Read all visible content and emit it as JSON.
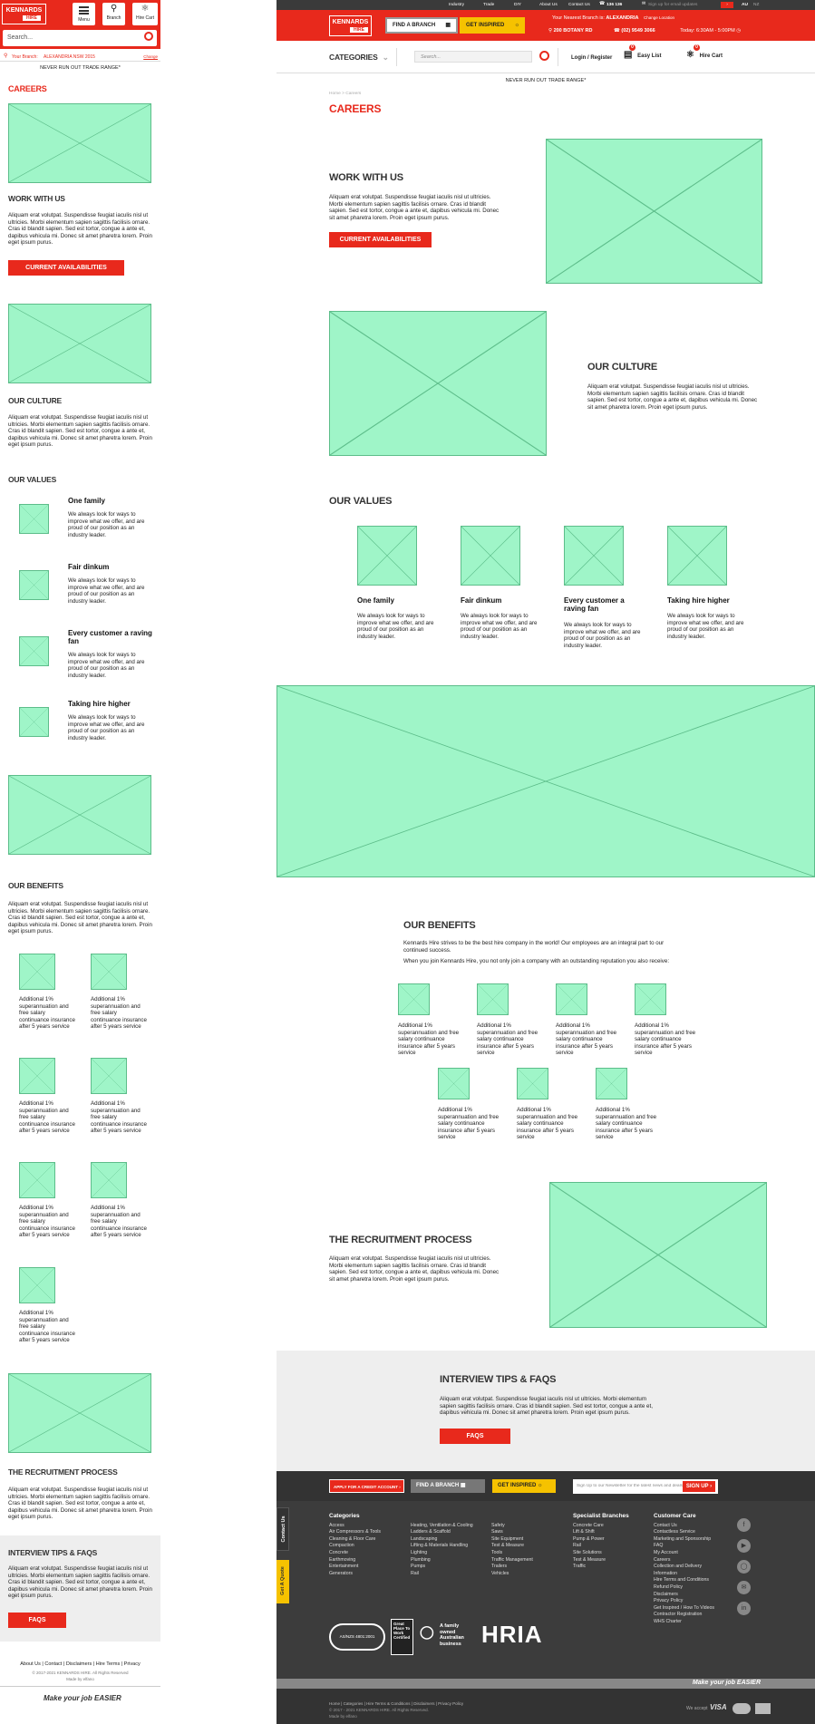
{
  "brand": {
    "name_top": "KENNARDS",
    "name_bottom": "HIRE",
    "tagline": "Make your job EASIER"
  },
  "colors": {
    "brand_red": "#e8291c",
    "yellow": "#f6c200",
    "placeholder_green": "#9ff5c8",
    "dark": "#333333",
    "footer_bg": "#3c3c3c"
  },
  "mobile": {
    "header": {
      "menu_label": "Menu",
      "branch_label": "Branch",
      "cart_label": "Hire Cart"
    },
    "search_placeholder": "Search...",
    "branch_bar": {
      "prefix": "Your Branch:",
      "branch": "ALEXANDRIA NSW 2015",
      "change": "Change"
    },
    "promo": "NEVER RUN OUT TRADE RANGE*",
    "page_title": "CAREERS",
    "work_title": "WORK WITH US",
    "lorem": "Aliquam erat volutpat. Suspendisse feugiat iaculis nisl ut ultricies. Morbi elementum sapien sagittis facilisis ornare. Cras id blandit sapien. Sed est tortor, congue a ante et, dapibus vehicula mi. Donec sit amet pharetra lorem. Proin eget ipsum purus.",
    "cta": "CURRENT AVAILABILITIES",
    "culture_title": "OUR CULTURE",
    "values_title": "OUR VALUES",
    "benefits_title": "OUR BENEFITS",
    "recruit_title": "THE RECRUITMENT PROCESS",
    "faq_title": "INTERVIEW TIPS & FAQs",
    "faq_btn": "FAQs",
    "footer_links": "About Us | Contact | Disclaimers | Hire Terms | Privacy",
    "copyright": "© 2017-2021 KENNARDS HIRE. All Rights Reserved",
    "made_by": "Made by elfano"
  },
  "values": [
    {
      "title": "One family",
      "text": "We always look for ways to improve what we offer, and are proud of our position as an industry leader."
    },
    {
      "title": "Fair dinkum",
      "text": "We always look for ways to improve what we offer, and are proud of our position as an industry leader."
    },
    {
      "title": "Every customer a raving fan",
      "text": "We always look for ways to improve what we offer, and are proud of our position as an industry leader."
    },
    {
      "title": "Taking hire higher",
      "text": "We always look for ways to improve what we offer, and are proud of our position as an industry leader."
    }
  ],
  "benefit_text": "Additional 1% superannuation and free salary continuance insurance after 5 years service",
  "desktop": {
    "topbar": {
      "industry": "Industry",
      "trade": "Trade",
      "diy": "DIY",
      "about": "About Us",
      "contact": "Contact Us",
      "phone": "136 136",
      "email_placeholder": "Sign up for email updates",
      "au": "AU",
      "nz": "NZ"
    },
    "find_branch": "FIND A BRANCH",
    "get_inspired": "GET INSPIRED",
    "nearest_prefix": "Your Nearest Branch is:",
    "nearest_branch": "ALEXANDRIA",
    "change_location": "Change Location",
    "address": "200 BOTANY RD",
    "branch_phone": "(02) 9549 3066",
    "hours": "Today: 6:30AM - 5:00PM",
    "categories": "CATEGORIES",
    "search_placeholder": "Search...",
    "login": "Login / Register",
    "easy_list": "Easy List",
    "hire_cart": "Hire Cart",
    "easy_count": "0",
    "cart_count": "0",
    "promo": "NEVER RUN OUT TRADE RANGE*",
    "breadcrumb": "Home > Careers",
    "page_title": "CAREERS",
    "work_title": "WORK WITH US",
    "lorem": "Aliquam erat volutpat. Suspendisse feugiat iaculis nisl ut ultricies. Morbi elementum sapien sagittis facilisis ornare. Cras id blandit sapien. Sed est tortor, congue a ante et, dapibus vehicula mi. Donec sit amet pharetra lorem. Proin eget ipsum purus.",
    "cta": "CURRENT AVAILABILITIES",
    "culture_title": "OUR CULTURE",
    "values_title": "OUR VALUES",
    "benefits_title": "OUR BENEFITS",
    "benefits_intro1": "Kennards Hire strives to be the best hire company in the world! Our employees are an integral part to our continued success.",
    "benefits_intro2": "When you join Kennards Hire, you not only join a company with an outstanding reputation you also receive:",
    "recruit_title": "THE RECRUITMENT PROCESS",
    "faq_title": "INTERVIEW TIPS & FAQs",
    "faq_btn": "FAQs",
    "footer": {
      "apply": "APPLY FOR A CREDIT ACCOUNT",
      "find_branch": "FIND A BRANCH",
      "get_inspired": "GET INSPIRED",
      "newsletter_placeholder": "Sign Up to our Newsletter for the latest news and deals",
      "signup": "SIGN UP",
      "contact_tab": "Contact Us",
      "quote_tab": "Get A Quote",
      "cat_title": "Categories",
      "cat1": [
        "Access",
        "Air Compressors & Tools",
        "Cleaning & Floor Care",
        "Compaction",
        "Concrete",
        "Earthmoving",
        "Entertainment",
        "Generators"
      ],
      "cat2": [
        "Heating, Ventilation & Cooling",
        "Ladders & Scaffold",
        "Landscaping",
        "Lifting & Materials Handling",
        "Lighting",
        "Plumbing",
        "Pumps",
        "Rail"
      ],
      "cat3": [
        "Safety",
        "Saws",
        "Site Equipment",
        "Test & Measure",
        "Tools",
        "Traffic Management",
        "Trailers",
        "Vehicles"
      ],
      "spec_title": "Specialist Branches",
      "spec": [
        "Concrete Care",
        "Lift & Shift",
        "Pump & Power",
        "Rail",
        "Site Solutions",
        "Test & Measure",
        "Traffic"
      ],
      "care_title": "Customer Care",
      "care": [
        "Contact Us",
        "Contactless Service",
        "Marketing and Sponsorship",
        "FAQ",
        "My Account",
        "Careers",
        "Collection and Delivery Information",
        "Hire Terms and Conditions",
        "Refund Policy",
        "Disclaimers",
        "Privacy Policy",
        "Get Inspired / How To Videos",
        "Contractor Registration",
        "WHS Charter"
      ],
      "badge_iso": "AS/NZS 4801:2001",
      "badge_gptw": "Great Place To Work Certified",
      "badge_aus": "A family owned Australian business",
      "badge_hria": "HRIA",
      "bottom_links": "Home | Categories | Hire Terms & Conditions | Disclaimers | Privacy Policy",
      "copyright": "© 2017 - 2021 KENNARDS HIRE. All Rights Reserved.",
      "made_by": "Made by elfano",
      "we_accept": "We accept",
      "visa": "VISA"
    }
  }
}
